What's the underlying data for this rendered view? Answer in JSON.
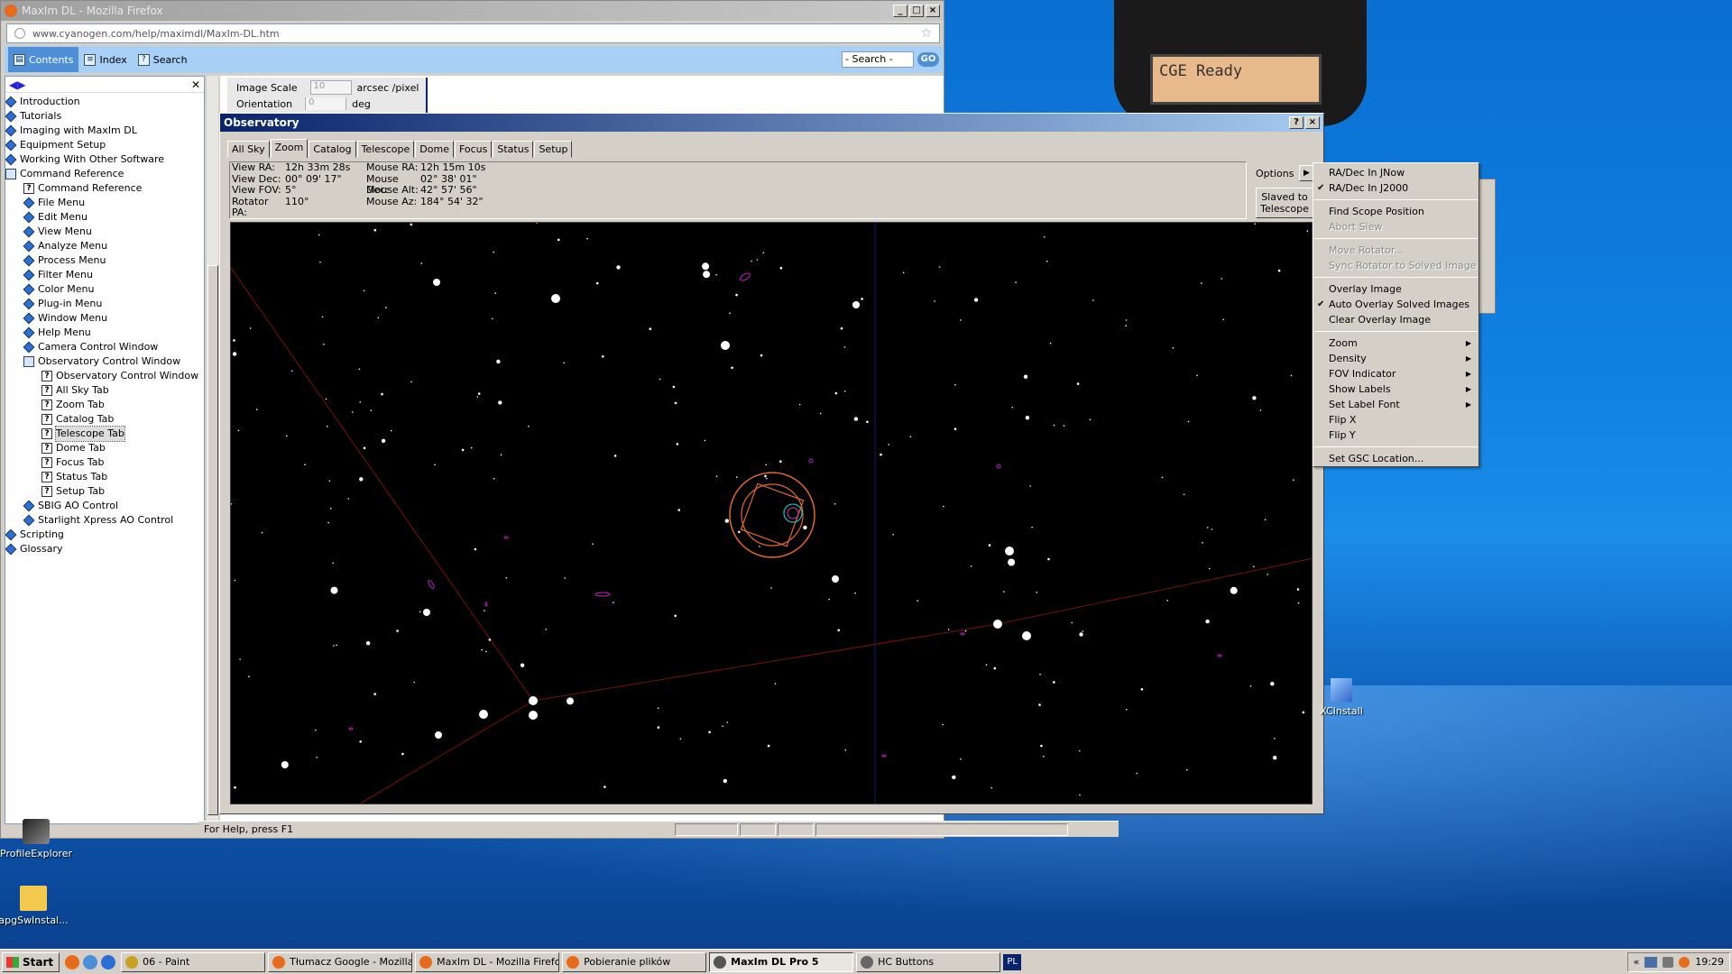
{
  "firefox": {
    "title": "MaxIm DL - Mozilla Firefox",
    "url": "www.cyanogen.com/help/maximdl/MaxIm-DL.htm",
    "tabs": [
      "Contents",
      "Index",
      "Search"
    ],
    "search_placeholder": "- Search -",
    "go_label": "GO",
    "toc": [
      {
        "label": "Introduction",
        "icon": "book",
        "indent": 0
      },
      {
        "label": "Tutorials",
        "icon": "book",
        "indent": 0
      },
      {
        "label": "Imaging with MaxIm DL",
        "icon": "book",
        "indent": 0
      },
      {
        "label": "Equipment Setup",
        "icon": "book",
        "indent": 0
      },
      {
        "label": "Working With Other Software",
        "icon": "book",
        "indent": 0
      },
      {
        "label": "Command Reference",
        "icon": "open-book",
        "indent": 0
      },
      {
        "label": "Command Reference",
        "icon": "page",
        "indent": 1
      },
      {
        "label": "File Menu",
        "icon": "book",
        "indent": 1
      },
      {
        "label": "Edit Menu",
        "icon": "book",
        "indent": 1
      },
      {
        "label": "View Menu",
        "icon": "book",
        "indent": 1
      },
      {
        "label": "Analyze Menu",
        "icon": "book",
        "indent": 1
      },
      {
        "label": "Process Menu",
        "icon": "book",
        "indent": 1
      },
      {
        "label": "Filter Menu",
        "icon": "book",
        "indent": 1
      },
      {
        "label": "Color Menu",
        "icon": "book",
        "indent": 1
      },
      {
        "label": "Plug-in Menu",
        "icon": "book",
        "indent": 1
      },
      {
        "label": "Window Menu",
        "icon": "book",
        "indent": 1
      },
      {
        "label": "Help Menu",
        "icon": "book",
        "indent": 1
      },
      {
        "label": "Camera Control Window",
        "icon": "book",
        "indent": 1
      },
      {
        "label": "Observatory Control Window",
        "icon": "open-book",
        "indent": 1
      },
      {
        "label": "Observatory Control Window",
        "icon": "page",
        "indent": 2
      },
      {
        "label": "All Sky Tab",
        "icon": "page",
        "indent": 2
      },
      {
        "label": "Zoom Tab",
        "icon": "page",
        "indent": 2
      },
      {
        "label": "Catalog Tab",
        "icon": "page",
        "indent": 2
      },
      {
        "label": "Telescope Tab",
        "icon": "page",
        "indent": 2,
        "selected": true
      },
      {
        "label": "Dome Tab",
        "icon": "page",
        "indent": 2
      },
      {
        "label": "Focus Tab",
        "icon": "page",
        "indent": 2
      },
      {
        "label": "Status Tab",
        "icon": "page",
        "indent": 2
      },
      {
        "label": "Setup Tab",
        "icon": "page",
        "indent": 2
      },
      {
        "label": "SBIG AO Control",
        "icon": "book",
        "indent": 1
      },
      {
        "label": "Starlight Xpress AO Control",
        "icon": "book",
        "indent": 1
      },
      {
        "label": "Scripting",
        "icon": "book",
        "indent": 0
      },
      {
        "label": "Glossary",
        "icon": "book",
        "indent": 0
      }
    ],
    "doc": {
      "image_scale_label": "Image Scale",
      "image_scale_value": "10",
      "image_scale_unit": "arcsec /pixel",
      "orientation_label": "Orientation",
      "orientation_value": "0",
      "orientation_unit": "deg"
    }
  },
  "status_bar": {
    "text": "For Help, press F1"
  },
  "observatory": {
    "title": "Observatory",
    "tabs": [
      "All Sky",
      "Zoom",
      "Catalog",
      "Telescope",
      "Dome",
      "Focus",
      "Status",
      "Setup"
    ],
    "selected_tab": "Zoom",
    "info": {
      "view_ra_label": "View RA:",
      "view_ra": "12h 33m 28s",
      "view_dec_label": "View Dec:",
      "view_dec": "00° 09' 17\"",
      "view_fov_label": "View FOV:",
      "view_fov": "5°",
      "rotator_pa_label": "Rotator PA:",
      "rotator_pa": "110°",
      "mouse_ra_label": "Mouse RA:",
      "mouse_ra": "12h 15m 10s",
      "mouse_dec_label": "Mouse Dec:",
      "mouse_dec": "02° 38' 01\"",
      "mouse_alt_label": "Mouse Alt:",
      "mouse_alt": "42° 57' 56\"",
      "mouse_az_label": "Mouse Az:",
      "mouse_az": "184° 54' 32\""
    },
    "options_label": "Options",
    "slaved_line1": "Slaved to",
    "slaved_line2": "Telescope"
  },
  "context_menu": {
    "groups": [
      [
        {
          "label": "RA/Dec In JNow"
        },
        {
          "label": "RA/Dec In J2000",
          "checked": true
        }
      ],
      [
        {
          "label": "Find Scope Position"
        },
        {
          "label": "Abort Slew",
          "disabled": true
        }
      ],
      [
        {
          "label": "Move Rotator...",
          "disabled": true
        },
        {
          "label": "Sync Rotator to Solved Image",
          "disabled": true
        }
      ],
      [
        {
          "label": "Overlay Image"
        },
        {
          "label": "Auto Overlay Solved Images",
          "checked": true
        },
        {
          "label": "Clear Overlay Image"
        }
      ],
      [
        {
          "label": "Zoom",
          "submenu": true
        },
        {
          "label": "Density",
          "submenu": true
        },
        {
          "label": "FOV Indicator",
          "submenu": true
        },
        {
          "label": "Show Labels",
          "submenu": true
        },
        {
          "label": "Set Label Font",
          "submenu": true
        },
        {
          "label": "Flip X"
        },
        {
          "label": "Flip Y"
        }
      ],
      [
        {
          "label": "Set GSC Location..."
        }
      ]
    ]
  },
  "hand_controller": {
    "display": "CGE Ready"
  },
  "desktop_icons": [
    {
      "label": "ProfileExplorer"
    },
    {
      "label": "apgSwInstal..."
    },
    {
      "label": "XCInstall"
    }
  ],
  "taskbar": {
    "start": "Start",
    "tasks": [
      {
        "label": "06 - Paint"
      },
      {
        "label": "Tłumacz Google - Mozilla ..."
      },
      {
        "label": "MaxIm DL - Mozilla Firefox"
      },
      {
        "label": "Pobieranie plików"
      },
      {
        "label": "MaxIm DL Pro 5",
        "active": true
      },
      {
        "label": "HC Buttons"
      }
    ],
    "language": "PL",
    "tray_expand": "«",
    "clock": "19:29"
  }
}
